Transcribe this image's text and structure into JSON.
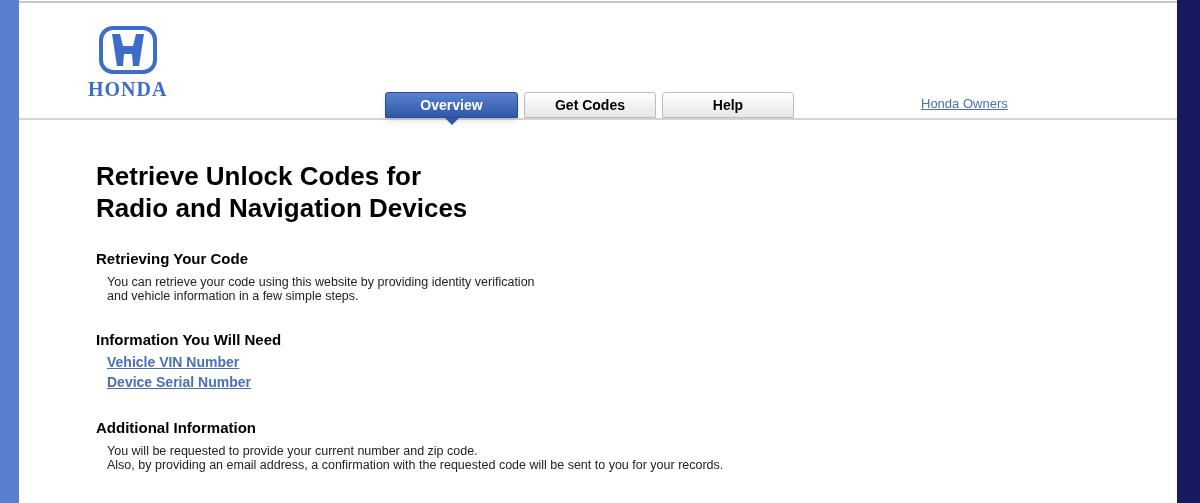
{
  "logo": {
    "wordmark": "HONDA"
  },
  "tabs": [
    {
      "label": "Overview",
      "selected": true
    },
    {
      "label": "Get Codes",
      "selected": false
    },
    {
      "label": "Help",
      "selected": false
    }
  ],
  "header_link": "Honda Owners",
  "title_lines": [
    "Retrieve Unlock Codes for",
    "Radio and Navigation Devices"
  ],
  "sections": [
    {
      "heading": "Retrieving Your Code",
      "kind": "text",
      "lines": [
        "You can retrieve your code using this website by providing identity verification",
        "and vehicle information in a few simple steps."
      ]
    },
    {
      "heading": "Information You Will Need",
      "kind": "links",
      "links": [
        "Vehicle VIN Number",
        "Device Serial Number"
      ]
    },
    {
      "heading": "Additional Information",
      "kind": "text",
      "lines": [
        "You will be requested to provide your current number and zip code.",
        "Also, by providing an email address, a confirmation with the requested code will be sent to you for your records."
      ]
    }
  ]
}
